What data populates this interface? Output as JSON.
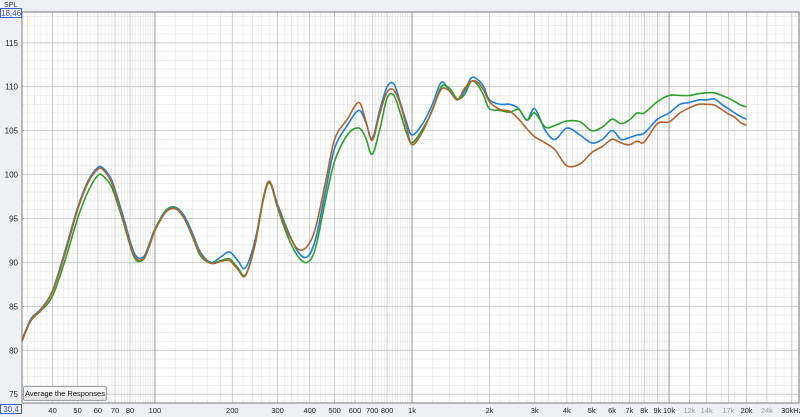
{
  "window": {
    "spl_label": "SPL",
    "top_readout": "18,46",
    "bottom_readout": "30,4",
    "button_label": "Average the Responses"
  },
  "colors": {
    "plot_bg": "#ffffff",
    "grid_minor": "#e3e3e3",
    "grid_major": "#9a9a9a",
    "tick_text": "#222222",
    "tick_text_dim": "#9a9a9a"
  },
  "chart_data": {
    "type": "line",
    "x_scale": "log",
    "xlim": [
      30.4,
      32000
    ],
    "ylim": [
      74,
      118.5
    ],
    "ylabel": "SPL",
    "y_ticks": [
      75,
      80,
      85,
      90,
      95,
      100,
      105,
      110,
      115
    ],
    "y_tick_labels": [
      "75",
      "80",
      "85",
      "90",
      "95",
      "100",
      "105",
      "110",
      "115"
    ],
    "x_ticks": [
      {
        "f": 40,
        "label": "40"
      },
      {
        "f": 50,
        "label": "50"
      },
      {
        "f": 60,
        "label": "60"
      },
      {
        "f": 70,
        "label": "70"
      },
      {
        "f": 80,
        "label": "80"
      },
      {
        "f": 100,
        "label": "100"
      },
      {
        "f": 200,
        "label": "200"
      },
      {
        "f": 300,
        "label": "300"
      },
      {
        "f": 400,
        "label": "400"
      },
      {
        "f": 500,
        "label": "500"
      },
      {
        "f": 600,
        "label": "600"
      },
      {
        "f": 700,
        "label": "700"
      },
      {
        "f": 800,
        "label": "800"
      },
      {
        "f": 1000,
        "label": "1k"
      },
      {
        "f": 2000,
        "label": "2k"
      },
      {
        "f": 3000,
        "label": "3k"
      },
      {
        "f": 4000,
        "label": "4k"
      },
      {
        "f": 5000,
        "label": "5k"
      },
      {
        "f": 6000,
        "label": "6k"
      },
      {
        "f": 7000,
        "label": "7k"
      },
      {
        "f": 8000,
        "label": "8k"
      },
      {
        "f": 9000,
        "label": "9k"
      },
      {
        "f": 10000,
        "label": "10k"
      },
      {
        "f": 12000,
        "label": "12k",
        "dim": true
      },
      {
        "f": 14000,
        "label": "14k",
        "dim": true
      },
      {
        "f": 17000,
        "label": "17k",
        "dim": true
      },
      {
        "f": 20000,
        "label": "20k"
      },
      {
        "f": 24000,
        "label": "24k",
        "dim": true
      },
      {
        "f": 30000,
        "label": "30kHz"
      }
    ],
    "major_x": [
      100,
      1000,
      10000
    ],
    "grid": true,
    "series": [
      {
        "color": "#1e7fd6",
        "x": [
          30.4,
          33,
          36,
          40,
          45,
          50,
          55,
          60,
          63,
          68,
          75,
          83,
          90,
          95,
          100,
          110,
          120,
          130,
          140,
          150,
          165,
          180,
          195,
          210,
          225,
          245,
          265,
          280,
          300,
          330,
          360,
          390,
          420,
          460,
          500,
          560,
          620,
          660,
          700,
          750,
          800,
          850,
          900,
          950,
          1000,
          1100,
          1200,
          1300,
          1400,
          1500,
          1600,
          1700,
          1800,
          1900,
          2000,
          2200,
          2400,
          2600,
          2800,
          3000,
          3300,
          3600,
          4000,
          4500,
          5000,
          5500,
          6000,
          6500,
          7000,
          7500,
          8000,
          9000,
          10000,
          11000,
          12000,
          13000,
          14000,
          15000,
          16000,
          17000,
          18000,
          19000,
          20000
        ],
        "y": [
          81.2,
          83.6,
          84.7,
          86.8,
          91.6,
          96.2,
          99.3,
          100.8,
          100.7,
          99.3,
          95.4,
          91.1,
          90.6,
          92.1,
          93.8,
          95.9,
          96.3,
          95.3,
          93.3,
          91.2,
          90.0,
          90.6,
          91.2,
          90.2,
          89.4,
          92.5,
          97.5,
          99.1,
          96.6,
          93.5,
          91.2,
          90.6,
          92.5,
          98.0,
          103.0,
          105.6,
          107.3,
          106.0,
          104.1,
          107.4,
          110.0,
          110.3,
          108.2,
          106.0,
          104.5,
          105.8,
          108.0,
          110.5,
          109.5,
          108.5,
          109.5,
          111.0,
          110.8,
          110.0,
          108.5,
          108.0,
          108.0,
          107.5,
          106.2,
          107.5,
          105.0,
          104.0,
          105.3,
          104.5,
          103.6,
          104.0,
          105.0,
          104.0,
          104.2,
          104.5,
          104.7,
          106.3,
          107.0,
          108.0,
          108.2,
          108.5,
          108.5,
          108.6,
          108.0,
          107.5,
          107.0,
          106.6,
          106.3
        ]
      },
      {
        "color": "#2aa02a",
        "x": [
          30.4,
          33,
          36,
          40,
          45,
          50,
          55,
          60,
          63,
          68,
          75,
          83,
          90,
          95,
          100,
          110,
          120,
          130,
          140,
          150,
          165,
          180,
          195,
          210,
          225,
          245,
          265,
          280,
          300,
          330,
          360,
          390,
          420,
          460,
          500,
          560,
          620,
          660,
          700,
          750,
          800,
          850,
          900,
          950,
          1000,
          1100,
          1200,
          1300,
          1400,
          1500,
          1600,
          1700,
          1800,
          1900,
          2000,
          2200,
          2400,
          2600,
          2800,
          3000,
          3300,
          3600,
          4000,
          4500,
          5000,
          5500,
          6000,
          6500,
          7000,
          7500,
          8000,
          9000,
          10000,
          11000,
          12000,
          13000,
          14000,
          15000,
          16000,
          17000,
          18000,
          19000,
          20000
        ],
        "y": [
          81.2,
          83.4,
          84.5,
          86.2,
          90.5,
          95.0,
          98.1,
          99.9,
          99.8,
          98.5,
          94.8,
          90.6,
          90.3,
          91.9,
          93.7,
          95.8,
          96.2,
          95.0,
          92.9,
          90.8,
          89.9,
          90.2,
          90.4,
          89.4,
          88.6,
          92.0,
          97.4,
          99.0,
          96.2,
          92.8,
          90.7,
          90.0,
          91.5,
          97.0,
          101.5,
          104.5,
          105.3,
          104.2,
          102.3,
          105.2,
          108.7,
          109.0,
          107.0,
          104.8,
          103.6,
          105.2,
          107.3,
          110.0,
          109.8,
          108.6,
          109.1,
          110.6,
          110.2,
          109.0,
          107.5,
          107.3,
          107.1,
          107.4,
          106.2,
          107.0,
          105.4,
          105.6,
          106.1,
          106.0,
          105.0,
          105.4,
          106.3,
          105.8,
          106.2,
          107.0,
          107.0,
          108.3,
          109.0,
          109.0,
          109.0,
          109.2,
          109.3,
          109.3,
          109.0,
          108.7,
          108.3,
          107.9,
          107.7
        ]
      },
      {
        "color": "#b4622a",
        "x": [
          30.4,
          33,
          36,
          40,
          45,
          50,
          55,
          60,
          63,
          68,
          75,
          83,
          90,
          95,
          100,
          110,
          120,
          130,
          140,
          150,
          165,
          180,
          195,
          210,
          225,
          245,
          265,
          280,
          300,
          330,
          360,
          390,
          420,
          460,
          500,
          560,
          620,
          660,
          700,
          750,
          800,
          850,
          900,
          950,
          1000,
          1100,
          1200,
          1300,
          1400,
          1500,
          1600,
          1700,
          1800,
          1900,
          2000,
          2200,
          2400,
          2600,
          2800,
          3000,
          3300,
          3600,
          4000,
          4500,
          5000,
          5500,
          6000,
          6500,
          7000,
          7500,
          8000,
          9000,
          10000,
          11000,
          12000,
          13000,
          14000,
          15000,
          16000,
          17000,
          18000,
          19000,
          20000
        ],
        "y": [
          81.0,
          83.5,
          84.6,
          86.7,
          91.3,
          96.0,
          99.1,
          100.6,
          100.5,
          99.0,
          95.0,
          90.8,
          90.4,
          91.8,
          93.6,
          95.7,
          96.1,
          95.0,
          93.0,
          91.0,
          89.9,
          90.1,
          90.2,
          89.2,
          88.5,
          92.1,
          97.6,
          99.2,
          96.4,
          93.3,
          91.5,
          91.8,
          93.8,
          99.0,
          104.0,
          106.3,
          108.2,
          106.2,
          103.9,
          107.0,
          109.4,
          109.6,
          108.0,
          105.5,
          103.4,
          104.9,
          107.4,
          109.7,
          109.5,
          108.5,
          109.8,
          110.6,
          110.5,
          109.6,
          108.3,
          107.4,
          107.2,
          106.3,
          105.2,
          104.3,
          103.6,
          102.8,
          101.0,
          101.2,
          102.5,
          103.2,
          104.0,
          103.6,
          103.4,
          103.8,
          103.7,
          105.8,
          106.0,
          107.0,
          107.6,
          108.0,
          108.0,
          107.9,
          107.4,
          106.9,
          106.5,
          105.9,
          105.6
        ]
      }
    ]
  }
}
